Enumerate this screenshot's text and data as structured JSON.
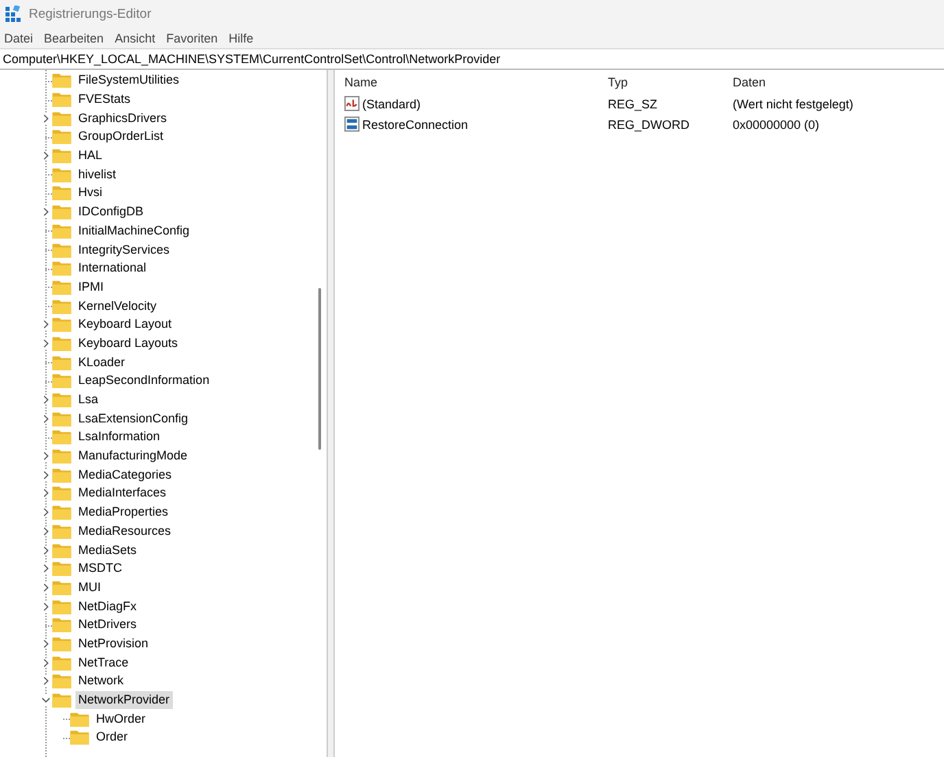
{
  "window": {
    "title": "Registrierungs-Editor"
  },
  "menu": [
    "Datei",
    "Bearbeiten",
    "Ansicht",
    "Favoriten",
    "Hilfe"
  ],
  "address": "Computer\\HKEY_LOCAL_MACHINE\\SYSTEM\\CurrentControlSet\\Control\\NetworkProvider",
  "tree": [
    {
      "label": "FileSystemUtilities",
      "has_children": false,
      "expanded": false,
      "selected": false
    },
    {
      "label": "FVEStats",
      "has_children": false,
      "expanded": false,
      "selected": false
    },
    {
      "label": "GraphicsDrivers",
      "has_children": true,
      "expanded": false,
      "selected": false
    },
    {
      "label": "GroupOrderList",
      "has_children": false,
      "expanded": false,
      "selected": false
    },
    {
      "label": "HAL",
      "has_children": true,
      "expanded": false,
      "selected": false
    },
    {
      "label": "hivelist",
      "has_children": false,
      "expanded": false,
      "selected": false
    },
    {
      "label": "Hvsi",
      "has_children": false,
      "expanded": false,
      "selected": false
    },
    {
      "label": "IDConfigDB",
      "has_children": true,
      "expanded": false,
      "selected": false
    },
    {
      "label": "InitialMachineConfig",
      "has_children": false,
      "expanded": false,
      "selected": false
    },
    {
      "label": "IntegrityServices",
      "has_children": false,
      "expanded": false,
      "selected": false
    },
    {
      "label": "International",
      "has_children": false,
      "expanded": false,
      "selected": false
    },
    {
      "label": "IPMI",
      "has_children": false,
      "expanded": false,
      "selected": false
    },
    {
      "label": "KernelVelocity",
      "has_children": false,
      "expanded": false,
      "selected": false
    },
    {
      "label": "Keyboard Layout",
      "has_children": true,
      "expanded": false,
      "selected": false
    },
    {
      "label": "Keyboard Layouts",
      "has_children": true,
      "expanded": false,
      "selected": false
    },
    {
      "label": "KLoader",
      "has_children": false,
      "expanded": false,
      "selected": false
    },
    {
      "label": "LeapSecondInformation",
      "has_children": false,
      "expanded": false,
      "selected": false
    },
    {
      "label": "Lsa",
      "has_children": true,
      "expanded": false,
      "selected": false
    },
    {
      "label": "LsaExtensionConfig",
      "has_children": true,
      "expanded": false,
      "selected": false
    },
    {
      "label": "LsaInformation",
      "has_children": false,
      "expanded": false,
      "selected": false
    },
    {
      "label": "ManufacturingMode",
      "has_children": true,
      "expanded": false,
      "selected": false
    },
    {
      "label": "MediaCategories",
      "has_children": true,
      "expanded": false,
      "selected": false
    },
    {
      "label": "MediaInterfaces",
      "has_children": true,
      "expanded": false,
      "selected": false
    },
    {
      "label": "MediaProperties",
      "has_children": true,
      "expanded": false,
      "selected": false
    },
    {
      "label": "MediaResources",
      "has_children": true,
      "expanded": false,
      "selected": false
    },
    {
      "label": "MediaSets",
      "has_children": true,
      "expanded": false,
      "selected": false
    },
    {
      "label": "MSDTC",
      "has_children": true,
      "expanded": false,
      "selected": false
    },
    {
      "label": "MUI",
      "has_children": true,
      "expanded": false,
      "selected": false
    },
    {
      "label": "NetDiagFx",
      "has_children": true,
      "expanded": false,
      "selected": false
    },
    {
      "label": "NetDrivers",
      "has_children": false,
      "expanded": false,
      "selected": false
    },
    {
      "label": "NetProvision",
      "has_children": true,
      "expanded": false,
      "selected": false
    },
    {
      "label": "NetTrace",
      "has_children": true,
      "expanded": false,
      "selected": false
    },
    {
      "label": "Network",
      "has_children": true,
      "expanded": false,
      "selected": false
    },
    {
      "label": "NetworkProvider",
      "has_children": true,
      "expanded": true,
      "selected": true,
      "children": [
        {
          "label": "HwOrder",
          "has_children": false,
          "expanded": false,
          "selected": false
        },
        {
          "label": "Order",
          "has_children": false,
          "expanded": false,
          "selected": false
        }
      ]
    }
  ],
  "values": {
    "columns": [
      "Name",
      "Typ",
      "Daten"
    ],
    "rows": [
      {
        "kind": "string",
        "name": "(Standard)",
        "type": "REG_SZ",
        "data": "(Wert nicht festgelegt)"
      },
      {
        "kind": "binary",
        "name": "RestoreConnection",
        "type": "REG_DWORD",
        "data": "0x00000000 (0)"
      }
    ]
  }
}
